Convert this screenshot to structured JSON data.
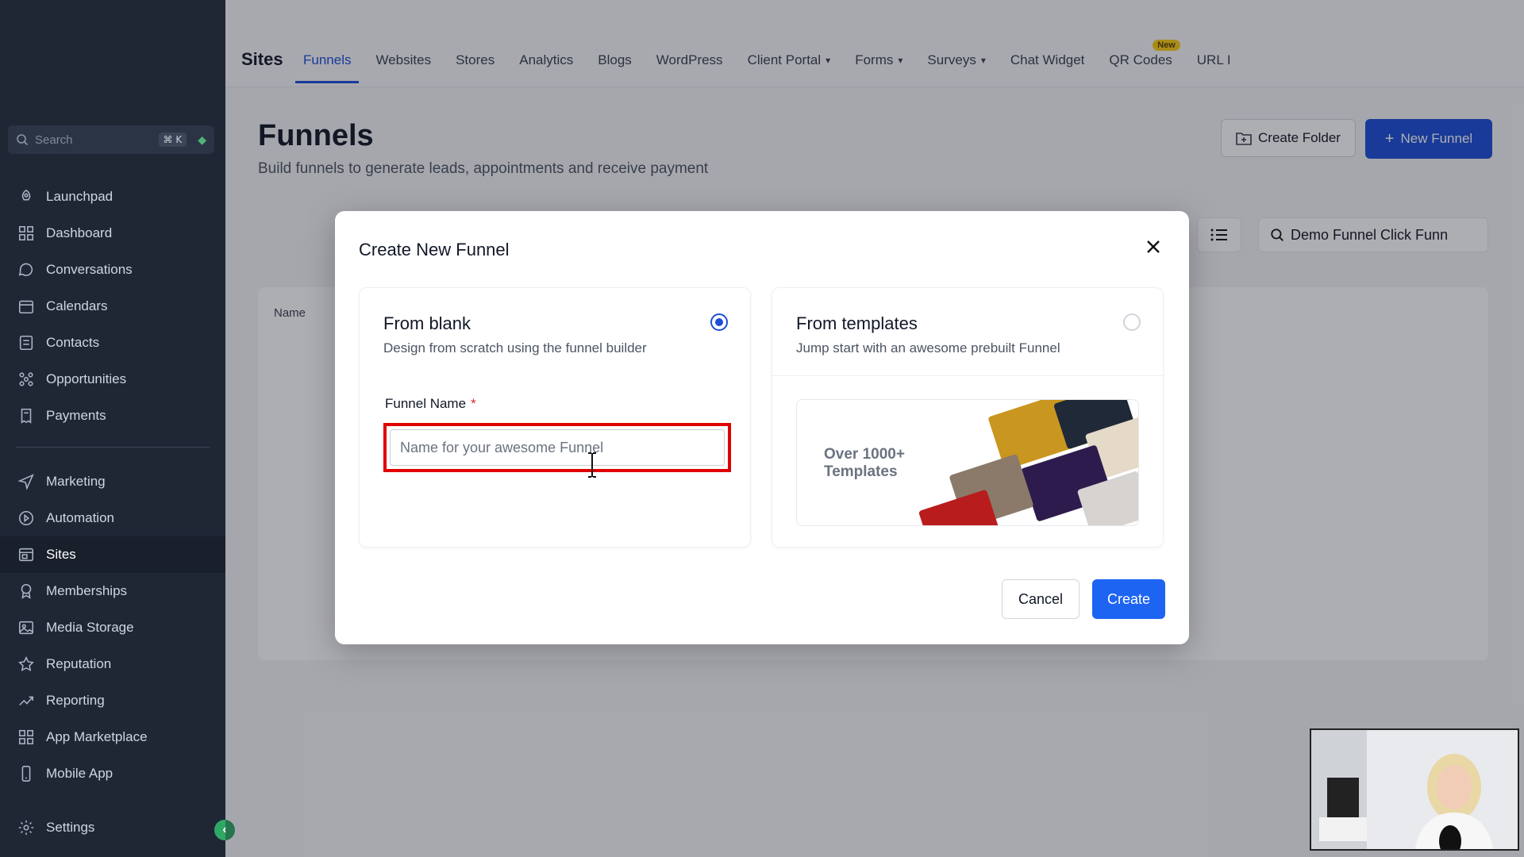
{
  "sidebar": {
    "search_placeholder": "Search",
    "search_shortcut": "⌘ K",
    "items": [
      {
        "label": "Launchpad",
        "icon": "rocket-icon"
      },
      {
        "label": "Dashboard",
        "icon": "grid-icon"
      },
      {
        "label": "Conversations",
        "icon": "chat-icon"
      },
      {
        "label": "Calendars",
        "icon": "calendar-icon"
      },
      {
        "label": "Contacts",
        "icon": "contacts-icon"
      },
      {
        "label": "Opportunities",
        "icon": "opportunities-icon"
      },
      {
        "label": "Payments",
        "icon": "receipt-icon"
      },
      {
        "label": "Marketing",
        "icon": "send-icon"
      },
      {
        "label": "Automation",
        "icon": "automation-icon"
      },
      {
        "label": "Sites",
        "icon": "sites-icon"
      },
      {
        "label": "Memberships",
        "icon": "badge-icon"
      },
      {
        "label": "Media Storage",
        "icon": "image-icon"
      },
      {
        "label": "Reputation",
        "icon": "star-icon"
      },
      {
        "label": "Reporting",
        "icon": "chart-line-icon"
      },
      {
        "label": "App Marketplace",
        "icon": "apps-icon"
      },
      {
        "label": "Mobile App",
        "icon": "mobile-icon"
      }
    ],
    "settings_label": "Settings"
  },
  "topbar": {
    "title": "Sites",
    "tabs": [
      {
        "label": "Funnels"
      },
      {
        "label": "Websites"
      },
      {
        "label": "Stores"
      },
      {
        "label": "Analytics"
      },
      {
        "label": "Blogs"
      },
      {
        "label": "WordPress"
      },
      {
        "label": "Client Portal"
      },
      {
        "label": "Forms"
      },
      {
        "label": "Surveys"
      },
      {
        "label": "Chat Widget"
      },
      {
        "label": "QR Codes",
        "badge": "New"
      },
      {
        "label": "URL I"
      }
    ]
  },
  "page": {
    "title": "Funnels",
    "subtitle": "Build funnels to generate leads, appointments and receive payment",
    "create_folder_label": "Create Folder",
    "new_funnel_label": "New Funnel",
    "search_value": "Demo Funnel Click Funn",
    "table_col_name": "Name"
  },
  "modal": {
    "title": "Create New Funnel",
    "blank": {
      "title": "From blank",
      "desc": "Design from scratch using the funnel builder",
      "selected": true,
      "field_label": "Funnel Name",
      "required_mark": "*",
      "placeholder": "Name for your awesome Funnel",
      "value": ""
    },
    "templates": {
      "title": "From templates",
      "desc": "Jump start with an awesome prebuilt Funnel",
      "selected": false,
      "image_text_1": "Over 1000+",
      "image_text_2": "Templates"
    },
    "cancel_label": "Cancel",
    "create_label": "Create"
  },
  "colors": {
    "sidebar_bg": "#1f2735",
    "accent": "#1d4ed8",
    "highlight_box": "#e00000"
  }
}
